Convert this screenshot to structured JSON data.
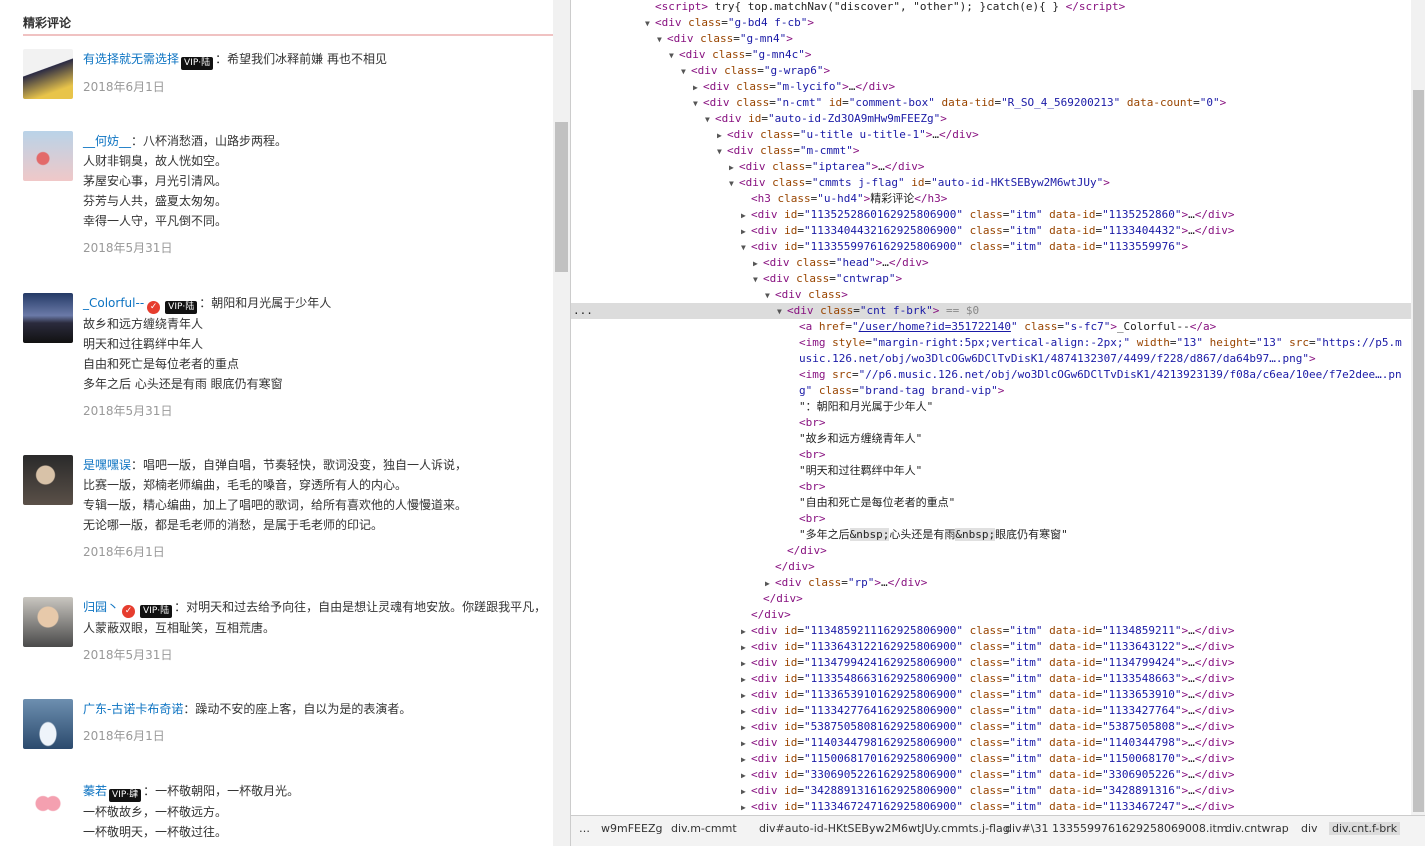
{
  "left_page": {
    "section_title": "精彩评论",
    "comments": [
      {
        "user": "有选择就无需选择",
        "badges": [
          "vip"
        ],
        "vip_text": "VIP·陆",
        "lines": [
          "希望我们冰释前嫌 再也不相见"
        ],
        "time": "2018年6月1日",
        "avatar_icon": "anime-avatar-icon"
      },
      {
        "user": "__何妨__",
        "badges": [],
        "lines": [
          "八杯消愁酒，山路步两程。",
          "人财非铜臭，故人恍如空。",
          "茅屋安心事，月光引清风。",
          "芬芳与人共，盛夏太匆匆。",
          "幸得一人守，平凡倒不同。"
        ],
        "time": "2018年5月31日",
        "avatar_icon": "sky-avatar-icon"
      },
      {
        "user": "_Colorful--",
        "badges": [
          "star",
          "vip"
        ],
        "vip_text": "VIP·陆",
        "lines": [
          "朝阳和月光属于少年人",
          "故乡和远方缠绕青年人",
          "明天和过往羁绊中年人",
          "自由和死亡是每位老者的重点",
          "多年之后 心头还是有雨 眼底仍有寒窗"
        ],
        "time": "2018年5月31日",
        "avatar_icon": "sunset-avatar-icon"
      },
      {
        "user": "是嘿嘿误",
        "badges": [],
        "lines": [
          "唱吧一版，自弹自唱，节奏轻快，歌词没变，独自一人诉说，",
          "比赛一版，郑楠老师编曲，毛毛的嗓音，穿透所有人的内心。",
          "专辑一版，精心编曲，加上了唱吧的歌词，给所有喜欢他的人慢慢道来。",
          "无论哪一版，都是毛老师的消愁，是属于毛老师的印记。"
        ],
        "time": "2018年6月1日",
        "avatar_icon": "person-avatar-icon"
      },
      {
        "user": "归园丶",
        "badges": [
          "star",
          "vip"
        ],
        "vip_text": "VIP·陆",
        "lines": [
          "对明天和过去给予向往，自由是想让灵魂有地安放。你蹉跟我平凡，",
          "人蒙蔽双眼，互相耻笑，互相荒唐。"
        ],
        "time": "2018年5月31日",
        "avatar_icon": "boy-avatar-icon"
      },
      {
        "user": "广东-古诺卡布奇诺",
        "badges": [],
        "lines": [
          "躁动不安的座上客，自以为是的表演者。"
        ],
        "time": "2018年6月1日",
        "avatar_icon": "sea-girl-avatar-icon"
      },
      {
        "user": "蓁若",
        "badges": [
          "vip"
        ],
        "vip_text": "VIP·肆",
        "lines": [
          "一杯敬朝阳，一杯敬月光。",
          "一杯敬故乡，一杯敬远方。",
          "一杯敬明天，一杯敬过往。"
        ],
        "time": "",
        "avatar_icon": "heart-avatar-icon"
      }
    ]
  },
  "devtools": {
    "more_menu": "...",
    "rows": [
      {
        "indent": 0,
        "arrow": "",
        "html": "<span class='tg'>&lt;script&gt;</span> try{ top.matchNav(\"discover\", \"other\"); }catch(e){ } <span class='tg'>&lt;/script&gt;</span>"
      },
      {
        "indent": 0,
        "arrow": "▼",
        "html": "<span class='tg'>&lt;div</span> <span class='an'>class</span>=<span class='av2'>\"g-bd4 f-cb\"</span><span class='tg'>&gt;</span>"
      },
      {
        "indent": 1,
        "arrow": "▼",
        "html": "<span class='tg'>&lt;div</span> <span class='an'>class</span>=<span class='av2'>\"g-mn4\"</span><span class='tg'>&gt;</span>"
      },
      {
        "indent": 2,
        "arrow": "▼",
        "html": "<span class='tg'>&lt;div</span> <span class='an'>class</span>=<span class='av2'>\"g-mn4c\"</span><span class='tg'>&gt;</span>"
      },
      {
        "indent": 3,
        "arrow": "▼",
        "html": "<span class='tg'>&lt;div</span> <span class='an'>class</span>=<span class='av2'>\"g-wrap6\"</span><span class='tg'>&gt;</span>"
      },
      {
        "indent": 4,
        "arrow": "▶",
        "html": "<span class='tg'>&lt;div</span> <span class='an'>class</span>=<span class='av2'>\"m-lycifo\"</span><span class='tg'>&gt;</span>…<span class='tg'>&lt;/div&gt;</span>"
      },
      {
        "indent": 4,
        "arrow": "▼",
        "html": "<span class='tg'>&lt;div</span> <span class='an'>class</span>=<span class='av2'>\"n-cmt\"</span> <span class='an'>id</span>=<span class='av2'>\"comment-box\"</span> <span class='an'>data-tid</span>=<span class='av2'>\"R_SO_4_569200213\"</span> <span class='an'>data-count</span>=<span class='av2'>\"0\"</span><span class='tg'>&gt;</span>"
      },
      {
        "indent": 5,
        "arrow": "▼",
        "html": "<span class='tg'>&lt;div</span> <span class='an'>id</span>=<span class='av2'>\"auto-id-Zd3OA9mHw9mFEEZg\"</span><span class='tg'>&gt;</span>"
      },
      {
        "indent": 6,
        "arrow": "▶",
        "html": "<span class='tg'>&lt;div</span> <span class='an'>class</span>=<span class='av2'>\"u-title u-title-1\"</span><span class='tg'>&gt;</span>…<span class='tg'>&lt;/div&gt;</span>"
      },
      {
        "indent": 6,
        "arrow": "▼",
        "html": "<span class='tg'>&lt;div</span> <span class='an'>class</span>=<span class='av2'>\"m-cmmt\"</span><span class='tg'>&gt;</span>"
      },
      {
        "indent": 7,
        "arrow": "▶",
        "html": "<span class='tg'>&lt;div</span> <span class='an'>class</span>=<span class='av2'>\"iptarea\"</span><span class='tg'>&gt;</span>…<span class='tg'>&lt;/div&gt;</span>"
      },
      {
        "indent": 7,
        "arrow": "▼",
        "html": "<span class='tg'>&lt;div</span> <span class='an'>class</span>=<span class='av2'>\"cmmts j-flag\"</span> <span class='an'>id</span>=<span class='av2'>\"auto-id-HKtSEByw2M6wtJUy\"</span><span class='tg'>&gt;</span>"
      },
      {
        "indent": 8,
        "arrow": "",
        "html": "<span class='tg'>&lt;h3</span> <span class='an'>class</span>=<span class='av2'>\"u-hd4\"</span><span class='tg'>&gt;</span>精彩评论<span class='tg'>&lt;/h3&gt;</span>"
      },
      {
        "indent": 8,
        "arrow": "▶",
        "html": "<span class='tg'>&lt;div</span> <span class='an'>id</span>=<span class='av2'>\"1135252860162925806900\"</span> <span class='an'>class</span>=<span class='av2'>\"itm\"</span> <span class='an'>data-id</span>=<span class='av2'>\"1135252860\"</span><span class='tg'>&gt;</span>…<span class='tg'>&lt;/div&gt;</span>"
      },
      {
        "indent": 8,
        "arrow": "▶",
        "html": "<span class='tg'>&lt;div</span> <span class='an'>id</span>=<span class='av2'>\"1133404432162925806900\"</span> <span class='an'>class</span>=<span class='av2'>\"itm\"</span> <span class='an'>data-id</span>=<span class='av2'>\"1133404432\"</span><span class='tg'>&gt;</span>…<span class='tg'>&lt;/div&gt;</span>"
      },
      {
        "indent": 8,
        "arrow": "▼",
        "html": "<span class='tg'>&lt;div</span> <span class='an'>id</span>=<span class='av2'>\"1133559976162925806900\"</span> <span class='an'>class</span>=<span class='av2'>\"itm\"</span> <span class='an'>data-id</span>=<span class='av2'>\"1133559976\"</span><span class='tg'>&gt;</span>"
      },
      {
        "indent": 9,
        "arrow": "▶",
        "html": "<span class='tg'>&lt;div</span> <span class='an'>class</span>=<span class='av2'>\"head\"</span><span class='tg'>&gt;</span>…<span class='tg'>&lt;/div&gt;</span>"
      },
      {
        "indent": 9,
        "arrow": "▼",
        "html": "<span class='tg'>&lt;div</span> <span class='an'>class</span>=<span class='av2'>\"cntwrap\"</span><span class='tg'>&gt;</span>"
      },
      {
        "indent": 10,
        "arrow": "▼",
        "html": "<span class='tg'>&lt;div</span> <span class='an'>class</span><span class='tg'>&gt;</span>"
      },
      {
        "indent": 11,
        "arrow": "▼",
        "sel": true,
        "html": "<span class='tg'>&lt;div</span> <span class='an'>class</span>=<span class='av2'>\"cnt f-brk\"</span><span class='tg'>&gt;</span> <span class='cmt'>== $0</span>"
      },
      {
        "indent": 12,
        "arrow": "",
        "html": "<span class='tg'>&lt;a</span> <span class='an'>href</span>=<span class='av2'>\"</span><span class='lk'>/user/home?id=351722140</span><span class='av2'>\"</span> <span class='an'>class</span>=<span class='av2'>\"s-fc7\"</span><span class='tg'>&gt;</span>_Colorful--<span class='tg'>&lt;/a&gt;</span>"
      },
      {
        "indent": 12,
        "arrow": "",
        "html": "<span class='tg'>&lt;img</span> <span class='an'>style</span>=<span class='av2'>\"margin-right:5px;vertical-align:-2px;\"</span> <span class='an'>width</span>=<span class='av2'>\"13\"</span> <span class='an'>height</span>=<span class='av2'>\"13\"</span> <span class='an'>src</span>=<span class='av2'>\"https://p5.m</span>"
      },
      {
        "indent": 12,
        "arrow": "",
        "html": "<span class='av2'>usic.126.net/obj/wo3DlcOGw6DClTvDisK1/4874132307/4499/f228/d867/da64b97….png\"</span><span class='tg'>&gt;</span>"
      },
      {
        "indent": 12,
        "arrow": "",
        "html": "<span class='tg'>&lt;img</span> <span class='an'>src</span>=<span class='av2'>\"//p6.music.126.net/obj/wo3DlcOGw6DClTvDisK1/4213923139/f08a/c6ea/10ee/f7e2dee….pn</span>"
      },
      {
        "indent": 12,
        "arrow": "",
        "html": "<span class='av2'>g\"</span> <span class='an'>class</span>=<span class='av2'>\"brand-tag brand-vip\"</span><span class='tg'>&gt;</span>"
      },
      {
        "indent": 12,
        "arrow": "",
        "html": "<span class='tx'>\"：朝阳和月光属于少年人\"</span>"
      },
      {
        "indent": 12,
        "arrow": "",
        "html": "<span class='tg'>&lt;br&gt;</span>"
      },
      {
        "indent": 12,
        "arrow": "",
        "html": "<span class='tx'>\"故乡和远方缠绕青年人\"</span>"
      },
      {
        "indent": 12,
        "arrow": "",
        "html": "<span class='tg'>&lt;br&gt;</span>"
      },
      {
        "indent": 12,
        "arrow": "",
        "html": "<span class='tx'>\"明天和过往羁绊中年人\"</span>"
      },
      {
        "indent": 12,
        "arrow": "",
        "html": "<span class='tg'>&lt;br&gt;</span>"
      },
      {
        "indent": 12,
        "arrow": "",
        "html": "<span class='tx'>\"自由和死亡是每位老者的重点\"</span>"
      },
      {
        "indent": 12,
        "arrow": "",
        "html": "<span class='tg'>&lt;br&gt;</span>"
      },
      {
        "indent": 12,
        "arrow": "",
        "html": "<span class='tx'>\"多年之后<span class='ent'>&amp;nbsp;</span>心头还是有雨<span class='ent'>&amp;nbsp;</span>眼底仍有寒窗\"</span>"
      },
      {
        "indent": 11,
        "arrow": "",
        "html": "<span class='tg'>&lt;/div&gt;</span>"
      },
      {
        "indent": 10,
        "arrow": "",
        "html": "<span class='tg'>&lt;/div&gt;</span>"
      },
      {
        "indent": 10,
        "arrow": "▶",
        "html": "<span class='tg'>&lt;div</span> <span class='an'>class</span>=<span class='av2'>\"rp\"</span><span class='tg'>&gt;</span>…<span class='tg'>&lt;/div&gt;</span>"
      },
      {
        "indent": 9,
        "arrow": "",
        "html": "<span class='tg'>&lt;/div&gt;</span>"
      },
      {
        "indent": 8,
        "arrow": "",
        "html": "<span class='tg'>&lt;/div&gt;</span>"
      },
      {
        "indent": 8,
        "arrow": "▶",
        "html": "<span class='tg'>&lt;div</span> <span class='an'>id</span>=<span class='av2'>\"1134859211162925806900\"</span> <span class='an'>class</span>=<span class='av2'>\"itm\"</span> <span class='an'>data-id</span>=<span class='av2'>\"1134859211\"</span><span class='tg'>&gt;</span>…<span class='tg'>&lt;/div&gt;</span>"
      },
      {
        "indent": 8,
        "arrow": "▶",
        "html": "<span class='tg'>&lt;div</span> <span class='an'>id</span>=<span class='av2'>\"1133643122162925806900\"</span> <span class='an'>class</span>=<span class='av2'>\"itm\"</span> <span class='an'>data-id</span>=<span class='av2'>\"1133643122\"</span><span class='tg'>&gt;</span>…<span class='tg'>&lt;/div&gt;</span>"
      },
      {
        "indent": 8,
        "arrow": "▶",
        "html": "<span class='tg'>&lt;div</span> <span class='an'>id</span>=<span class='av2'>\"1134799424162925806900\"</span> <span class='an'>class</span>=<span class='av2'>\"itm\"</span> <span class='an'>data-id</span>=<span class='av2'>\"1134799424\"</span><span class='tg'>&gt;</span>…<span class='tg'>&lt;/div&gt;</span>"
      },
      {
        "indent": 8,
        "arrow": "▶",
        "html": "<span class='tg'>&lt;div</span> <span class='an'>id</span>=<span class='av2'>\"1133548663162925806900\"</span> <span class='an'>class</span>=<span class='av2'>\"itm\"</span> <span class='an'>data-id</span>=<span class='av2'>\"1133548663\"</span><span class='tg'>&gt;</span>…<span class='tg'>&lt;/div&gt;</span>"
      },
      {
        "indent": 8,
        "arrow": "▶",
        "html": "<span class='tg'>&lt;div</span> <span class='an'>id</span>=<span class='av2'>\"1133653910162925806900\"</span> <span class='an'>class</span>=<span class='av2'>\"itm\"</span> <span class='an'>data-id</span>=<span class='av2'>\"1133653910\"</span><span class='tg'>&gt;</span>…<span class='tg'>&lt;/div&gt;</span>"
      },
      {
        "indent": 8,
        "arrow": "▶",
        "html": "<span class='tg'>&lt;div</span> <span class='an'>id</span>=<span class='av2'>\"1133427764162925806900\"</span> <span class='an'>class</span>=<span class='av2'>\"itm\"</span> <span class='an'>data-id</span>=<span class='av2'>\"1133427764\"</span><span class='tg'>&gt;</span>…<span class='tg'>&lt;/div&gt;</span>"
      },
      {
        "indent": 8,
        "arrow": "▶",
        "html": "<span class='tg'>&lt;div</span> <span class='an'>id</span>=<span class='av2'>\"5387505808162925806900\"</span> <span class='an'>class</span>=<span class='av2'>\"itm\"</span> <span class='an'>data-id</span>=<span class='av2'>\"5387505808\"</span><span class='tg'>&gt;</span>…<span class='tg'>&lt;/div&gt;</span>"
      },
      {
        "indent": 8,
        "arrow": "▶",
        "html": "<span class='tg'>&lt;div</span> <span class='an'>id</span>=<span class='av2'>\"1140344798162925806900\"</span> <span class='an'>class</span>=<span class='av2'>\"itm\"</span> <span class='an'>data-id</span>=<span class='av2'>\"1140344798\"</span><span class='tg'>&gt;</span>…<span class='tg'>&lt;/div&gt;</span>"
      },
      {
        "indent": 8,
        "arrow": "▶",
        "html": "<span class='tg'>&lt;div</span> <span class='an'>id</span>=<span class='av2'>\"1150068170162925806900\"</span> <span class='an'>class</span>=<span class='av2'>\"itm\"</span> <span class='an'>data-id</span>=<span class='av2'>\"1150068170\"</span><span class='tg'>&gt;</span>…<span class='tg'>&lt;/div&gt;</span>"
      },
      {
        "indent": 8,
        "arrow": "▶",
        "html": "<span class='tg'>&lt;div</span> <span class='an'>id</span>=<span class='av2'>\"3306905226162925806900\"</span> <span class='an'>class</span>=<span class='av2'>\"itm\"</span> <span class='an'>data-id</span>=<span class='av2'>\"3306905226\"</span><span class='tg'>&gt;</span>…<span class='tg'>&lt;/div&gt;</span>"
      },
      {
        "indent": 8,
        "arrow": "▶",
        "html": "<span class='tg'>&lt;div</span> <span class='an'>id</span>=<span class='av2'>\"3428891316162925806900\"</span> <span class='an'>class</span>=<span class='av2'>\"itm\"</span> <span class='an'>data-id</span>=<span class='av2'>\"3428891316\"</span><span class='tg'>&gt;</span>…<span class='tg'>&lt;/div&gt;</span>"
      },
      {
        "indent": 8,
        "arrow": "▶",
        "html": "<span class='tg'>&lt;div</span> <span class='an'>id</span>=<span class='av2'>\"1133467247162925806900\"</span> <span class='an'>class</span>=<span class='av2'>\"itm\"</span> <span class='an'>data-id</span>=<span class='av2'>\"1133467247\"</span><span class='tg'>&gt;</span>…<span class='tg'>&lt;/div&gt;</span>"
      }
    ],
    "breadcrumbs": [
      "…",
      "w9mFEEZg",
      "div.m-cmmt",
      "div#auto-id-HKtSEByw2M6wtJUy.cmmts.j-flag",
      "div#\\31 1335599761629258069008.itm",
      "div.cntwrap",
      "div",
      "div.cnt.f-brk"
    ]
  },
  "colors": {
    "link": "#0c73c2",
    "tag": "#881280",
    "attr_name": "#994500",
    "attr_value": "#1a1aa6",
    "vip_star": "#e63d2e"
  }
}
